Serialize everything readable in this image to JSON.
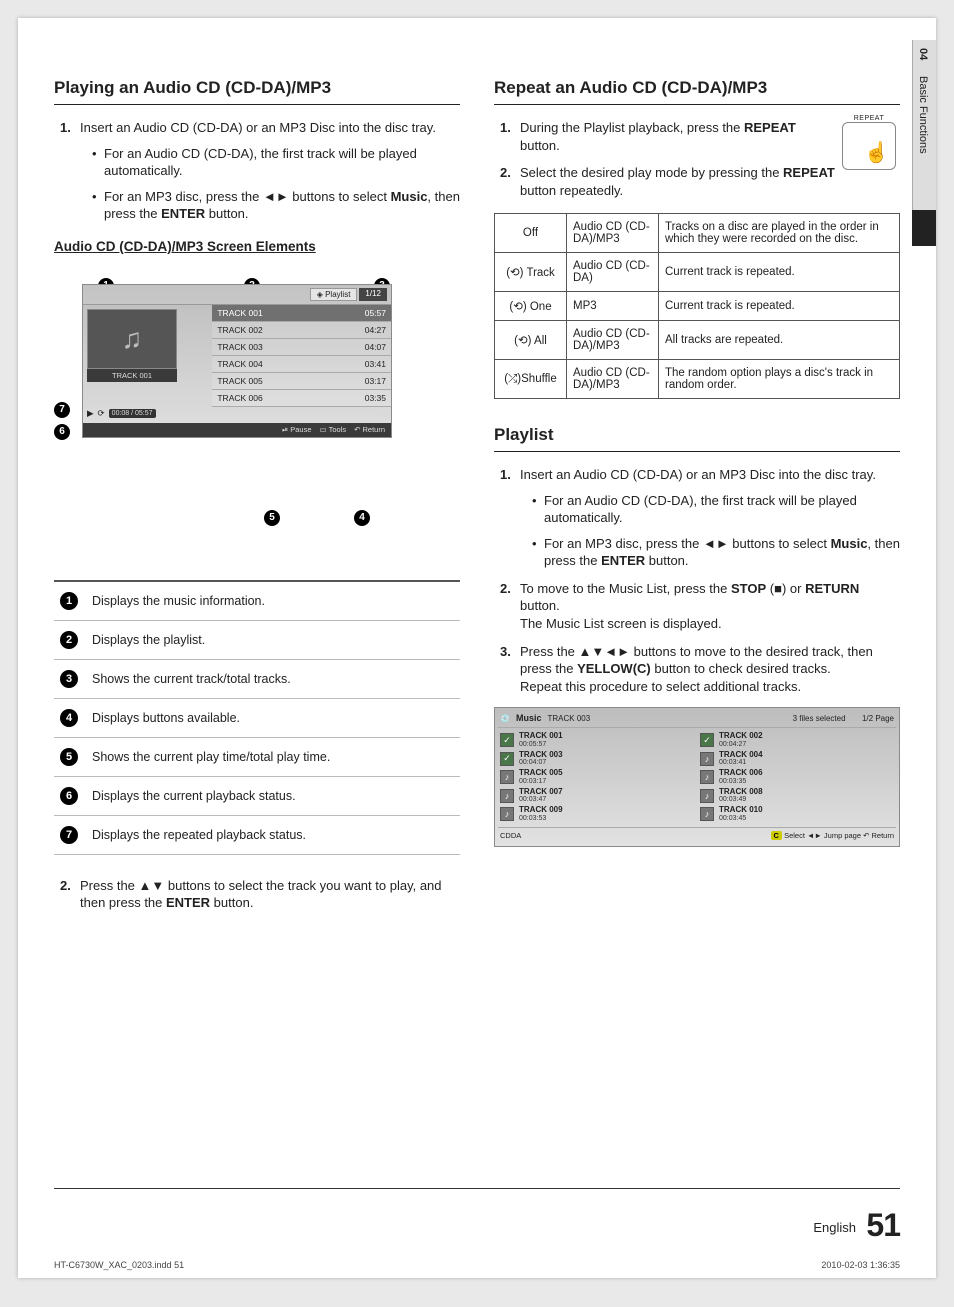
{
  "side_tab": {
    "chapter": "04",
    "title": "Basic Functions"
  },
  "left": {
    "heading": "Playing an Audio CD (CD-DA)/MP3",
    "step1_num": "1.",
    "step1": "Insert an Audio CD (CD-DA) or an MP3 Disc into the disc tray.",
    "b1": "For an Audio CD (CD-DA), the first track will be played automatically.",
    "b2_a": "For an MP3 disc, press the ◄► buttons to select ",
    "b2_bold1": "Music",
    "b2_b": ", then press the ",
    "b2_bold2": "ENTER",
    "b2_c": " button.",
    "sub": "Audio CD (CD-DA)/MP3 Screen Elements",
    "screen": {
      "tab_playlist": "Playlist",
      "tab_count": "1/12",
      "art_label": "TRACK 001",
      "tracks": [
        {
          "name": "TRACK 001",
          "dur": "05:57"
        },
        {
          "name": "TRACK 002",
          "dur": "04:27"
        },
        {
          "name": "TRACK 003",
          "dur": "04:07"
        },
        {
          "name": "TRACK 004",
          "dur": "03:41"
        },
        {
          "name": "TRACK 005",
          "dur": "03:17"
        },
        {
          "name": "TRACK 006",
          "dur": "03:35"
        }
      ],
      "time": "00:08 / 05:57",
      "play": "▶",
      "repeat": "⟳",
      "foot_pause": "Pause",
      "foot_tools": "Tools",
      "foot_return": "Return"
    },
    "legend": [
      "Displays the music information.",
      "Displays the playlist.",
      "Shows the current track/total tracks.",
      "Displays buttons available.",
      "Shows the current play time/total play time.",
      "Displays the current playback status.",
      "Displays the repeated playback status."
    ],
    "step2_num": "2.",
    "step2_a": "Press the ▲▼ buttons to select the track you want to play, and then press the ",
    "step2_bold": "ENTER",
    "step2_b": " button."
  },
  "right": {
    "heading1": "Repeat an Audio CD (CD-DA)/MP3",
    "r1_num": "1.",
    "r1_a": "During the Playlist playback, press the ",
    "r1_bold": "REPEAT",
    "r1_b": " button.",
    "r2_num": "2.",
    "r2_a": "Select the desired play mode by pressing the ",
    "r2_bold": "REPEAT",
    "r2_b": " button repeatedly.",
    "remote_label": "REPEAT",
    "repeat_rows": [
      {
        "mode": "Off",
        "type": "Audio CD (CD-DA)/MP3",
        "desc": "Tracks on a disc are played in the order in which they were recorded on the disc."
      },
      {
        "mode": "(⟲) Track",
        "type": "Audio CD (CD-DA)",
        "desc": "Current track is repeated."
      },
      {
        "mode": "(⟲) One",
        "type": "MP3",
        "desc": "Current track is repeated."
      },
      {
        "mode": "(⟲) All",
        "type": "Audio CD (CD-DA)/MP3",
        "desc": "All tracks are repeated."
      },
      {
        "mode": "(⤮)Shuffle",
        "type": "Audio CD (CD-DA)/MP3",
        "desc": "The random option plays a disc's track in random order."
      }
    ],
    "heading2": "Playlist",
    "p1_num": "1.",
    "p1": "Insert an Audio CD (CD-DA) or an MP3 Disc into the disc tray.",
    "p1b1": "For an Audio CD (CD-DA), the first track will be played automatically.",
    "p1b2_a": "For an MP3 disc, press the ◄► buttons to select ",
    "p1b2_bold1": "Music",
    "p1b2_b": ", then press the ",
    "p1b2_bold2": "ENTER",
    "p1b2_c": " button.",
    "p2_num": "2.",
    "p2_a": "To move to the Music List, press the ",
    "p2_bold1": "STOP",
    "p2_b": " (■) or ",
    "p2_bold2": "RETURN",
    "p2_c": " button.",
    "p2_d": "The Music List screen is displayed.",
    "p3_num": "3.",
    "p3_a": "Press the ▲▼◄► buttons to move to the desired track, then press the ",
    "p3_bold": "YELLOW(C)",
    "p3_b": " button to check desired tracks.",
    "p3_c": "Repeat this procedure to select additional tracks.",
    "music": {
      "title": "Music",
      "current": "TRACK 003",
      "sel": "3 files selected",
      "page": "1/2 Page",
      "cells": [
        {
          "t": "TRACK 001",
          "d": "00:05:57",
          "on": true
        },
        {
          "t": "TRACK 002",
          "d": "00:04:27",
          "on": true
        },
        {
          "t": "TRACK 003",
          "d": "00:04:07",
          "on": true
        },
        {
          "t": "TRACK 004",
          "d": "00:03:41",
          "on": false
        },
        {
          "t": "TRACK 005",
          "d": "00:03:17",
          "on": false
        },
        {
          "t": "TRACK 006",
          "d": "00:03:35",
          "on": false
        },
        {
          "t": "TRACK 007",
          "d": "00:03:47",
          "on": false
        },
        {
          "t": "TRACK 008",
          "d": "00:03:49",
          "on": false
        },
        {
          "t": "TRACK 009",
          "d": "00:03:53",
          "on": false
        },
        {
          "t": "TRACK 010",
          "d": "00:03:45",
          "on": false
        }
      ],
      "ftr_left": "CDDA",
      "ftr_right": "Select   ◄► Jump page   ↶ Return",
      "ftr_sel_key": "C"
    }
  },
  "footer": {
    "lang": "English",
    "page": "51",
    "file": "HT-C6730W_XAC_0203.indd   51",
    "date": "2010-02-03   1:36:35"
  }
}
